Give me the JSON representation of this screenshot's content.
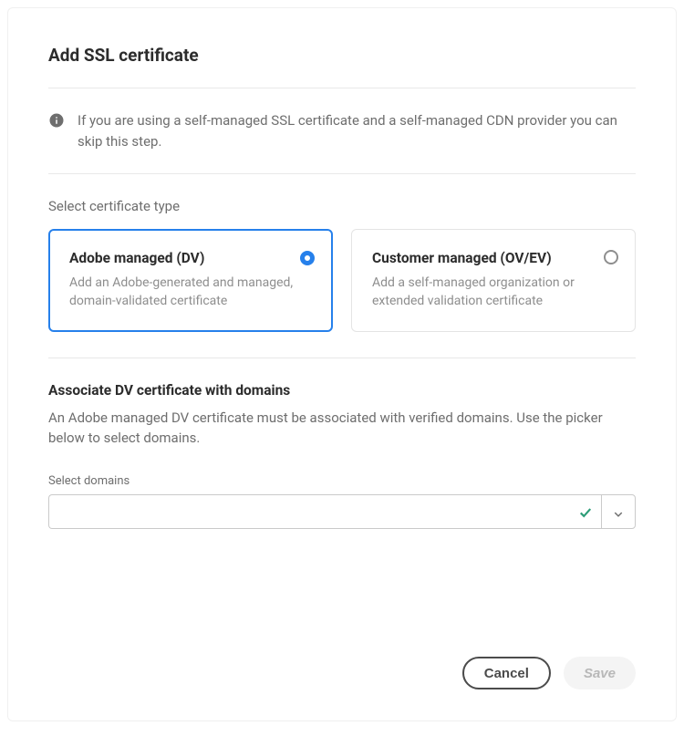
{
  "dialog": {
    "title": "Add SSL certificate"
  },
  "info": {
    "text": "If you are using a self-managed SSL certificate and a self-managed CDN provider you can skip this step."
  },
  "certType": {
    "label": "Select certificate type",
    "options": {
      "adobe": {
        "title": "Adobe managed (DV)",
        "desc": "Add an Adobe-generated and managed, domain-validated certificate",
        "selected": true
      },
      "customer": {
        "title": "Customer managed (OV/EV)",
        "desc": "Add a self-managed organization or extended validation certificate",
        "selected": false
      }
    }
  },
  "associate": {
    "title": "Associate DV certificate with domains",
    "desc": "An Adobe managed DV certificate must be associated with verified domains. Use the picker below to select domains.",
    "fieldLabel": "Select domains",
    "value": ""
  },
  "footer": {
    "cancel": "Cancel",
    "save": "Save"
  }
}
